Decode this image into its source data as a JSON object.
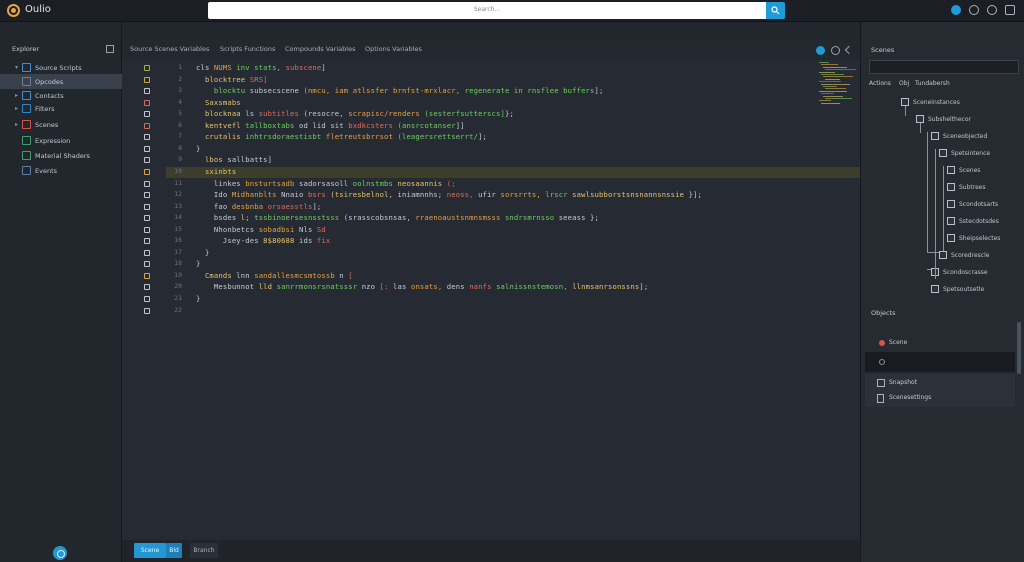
{
  "app": {
    "name": "Oulio"
  },
  "search": {
    "placeholder": "Search..."
  },
  "sidebar": {
    "header": "Explorer",
    "items": [
      {
        "label": "Source Scripts",
        "icon": "folder-icon",
        "color": "#3a8fd6",
        "active": false,
        "arrow": "▾"
      },
      {
        "label": "Opcodes",
        "icon": "file-icon",
        "color": "#6f7e92",
        "active": true,
        "arrow": ""
      },
      {
        "label": "Contacts",
        "icon": "folder-icon",
        "color": "#3a8fd6",
        "active": false,
        "arrow": "▸"
      },
      {
        "label": "Filters",
        "icon": "folder-icon",
        "color": "#2f86c9",
        "active": false,
        "arrow": "▸"
      },
      {
        "label": "Scenes",
        "icon": "folder-red-icon",
        "color": "#d8534a",
        "active": false,
        "arrow": "▸"
      },
      {
        "label": "Expression",
        "icon": "file-green-icon",
        "color": "#3f9e6b",
        "active": false,
        "arrow": ""
      },
      {
        "label": "Material Shaders",
        "icon": "file-green-icon",
        "color": "#3f9e6b",
        "active": false,
        "arrow": ""
      },
      {
        "label": "Events",
        "icon": "file-icon",
        "color": "#5b7fa8",
        "active": false,
        "arrow": ""
      }
    ]
  },
  "tabs": [
    {
      "label": "Source Scenes Variables"
    },
    {
      "label": "Scripts Functions"
    },
    {
      "label": "Compounds Variables"
    },
    {
      "label": "Options Variables"
    }
  ],
  "editor": {
    "line_numbers": [
      "1",
      "2",
      "3",
      "4",
      "5",
      "6",
      "7",
      "8",
      "9",
      "10",
      "11",
      "12",
      "13",
      "14",
      "15",
      "16",
      "17",
      "18",
      "19",
      "20",
      "21",
      "22"
    ],
    "lines": [
      [
        {
          "t": "cls ",
          "c": "#c3cdd6"
        },
        {
          "t": "NUMS ",
          "c": "#e8a33d"
        },
        {
          "t": "inv stats, ",
          "c": "#6fd15f"
        },
        {
          "t": "subscene",
          "c": "#e06d5c"
        },
        {
          "t": "]",
          "c": "#c3cdd6"
        }
      ],
      [
        {
          "t": "  blocktree ",
          "c": "#e8c46a"
        },
        {
          "t": "SRS]",
          "c": "#e06d5c"
        }
      ],
      [
        {
          "t": "    blocktu ",
          "c": "#6fd15f"
        },
        {
          "t": "subsecscene ",
          "c": "#c3cdd6"
        },
        {
          "t": "(nmcu, iam atlssfer brnfst-mrxlacr, ",
          "c": "#e8a33d"
        },
        {
          "t": "regenerate in rnsflee buffers",
          "c": "#6fd15f"
        },
        {
          "t": "];",
          "c": "#c3cdd6"
        }
      ],
      [
        {
          "t": "  Saxsmabs ",
          "c": "#e8c46a"
        }
      ],
      [
        {
          "t": "  blocknaa ",
          "c": "#e8c46a"
        },
        {
          "t": "ls ",
          "c": "#c3cdd6"
        },
        {
          "t": "subtitles ",
          "c": "#e06d5c"
        },
        {
          "t": "(resocre, ",
          "c": "#c3cdd6"
        },
        {
          "t": "scrapisc/renders ",
          "c": "#e8a33d"
        },
        {
          "t": "(sesterfsutterscs]",
          "c": "#6fd15f"
        },
        {
          "t": "};",
          "c": "#c3cdd6"
        }
      ],
      [
        {
          "t": "  kentvefl ",
          "c": "#e8c46a"
        },
        {
          "t": "tallboxtabs ",
          "c": "#6fd15f"
        },
        {
          "t": "od lid sit ",
          "c": "#c3cdd6"
        },
        {
          "t": "bxdkcsters ",
          "c": "#e06d5c"
        },
        {
          "t": "(ansrcotanser",
          "c": "#6fd15f"
        },
        {
          "t": "]]",
          "c": "#c3cdd6"
        }
      ],
      [
        {
          "t": "  crutalis ",
          "c": "#e8c46a"
        },
        {
          "t": "inhtrsdoraestisbt ",
          "c": "#6fd15f"
        },
        {
          "t": "fletreutsbrrsot ",
          "c": "#e8a33d"
        },
        {
          "t": "(leagersrettserrt/",
          "c": "#6fd15f"
        },
        {
          "t": "];",
          "c": "#c3cdd6"
        }
      ],
      [
        {
          "t": "}",
          "c": "#c3cdd6"
        }
      ],
      [
        {
          "t": "  lbos ",
          "c": "#e8c46a"
        },
        {
          "t": "sallbatts]",
          "c": "#c3cdd6"
        }
      ],
      [
        {
          "t": "  sxinbts ",
          "c": "#e8c46a"
        }
      ],
      [
        {
          "t": "    linkes ",
          "c": "#c3cdd6"
        },
        {
          "t": "bnsturtsadb ",
          "c": "#e8a33d"
        },
        {
          "t": "sadorsasoll ",
          "c": "#c3cdd6"
        },
        {
          "t": "oolnstmbs ",
          "c": "#6fd15f"
        },
        {
          "t": "neosaannis ",
          "c": "#e8c46a"
        },
        {
          "t": "(;",
          "c": "#e06d5c"
        }
      ],
      [
        {
          "t": "    Ido ",
          "c": "#c3cdd6"
        },
        {
          "t": "Midhanblts ",
          "c": "#e8a33d"
        },
        {
          "t": "Nnaio ",
          "c": "#c3cdd6"
        },
        {
          "t": "bsrs ",
          "c": "#e06d5c"
        },
        {
          "t": "(tsiresbelnol, ",
          "c": "#e8c46a"
        },
        {
          "t": "iniamnnhs; ",
          "c": "#c3cdd6"
        },
        {
          "t": "neoss, ",
          "c": "#e06d5c"
        },
        {
          "t": "ufir ",
          "c": "#c3cdd6"
        },
        {
          "t": "sorsrrts, ",
          "c": "#e8a33d"
        },
        {
          "t": "lrscr ",
          "c": "#6fd15f"
        },
        {
          "t": "sawlsubborstsnsnannsnssie ",
          "c": "#e8c46a"
        },
        {
          "t": "}];",
          "c": "#c3cdd6"
        }
      ],
      [
        {
          "t": "    fao ",
          "c": "#c3cdd6"
        },
        {
          "t": "desbnba ",
          "c": "#e8a33d"
        },
        {
          "t": "orsaesstls",
          "c": "#e06d5c"
        },
        {
          "t": "];",
          "c": "#c3cdd6"
        }
      ],
      [
        {
          "t": "    bsdes ",
          "c": "#c3cdd6"
        },
        {
          "t": "l; ",
          "c": "#e8c46a"
        },
        {
          "t": "tssbinoersesnsstsss ",
          "c": "#6fd15f"
        },
        {
          "t": "(srasscobsnsas, ",
          "c": "#c3cdd6"
        },
        {
          "t": "rraenoaustsnmnsmsss ",
          "c": "#e8a33d"
        },
        {
          "t": "sndrsmrnsso ",
          "c": "#6fd15f"
        },
        {
          "t": "seeass ",
          "c": "#c3cdd6"
        },
        {
          "t": "};",
          "c": "#c3cdd6"
        }
      ],
      [
        {
          "t": "    Nhonbetcs ",
          "c": "#c3cdd6"
        },
        {
          "t": "sobadbsi ",
          "c": "#e8a33d"
        },
        {
          "t": "Nls ",
          "c": "#c3cdd6"
        },
        {
          "t": "Sd",
          "c": "#e06d5c"
        }
      ],
      [
        {
          "t": "      Jsey-des ",
          "c": "#c3cdd6"
        },
        {
          "t": "8$80688 ",
          "c": "#e8c46a"
        },
        {
          "t": "ids ",
          "c": "#c3cdd6"
        },
        {
          "t": "fix",
          "c": "#e06d5c"
        }
      ],
      [
        {
          "t": "  }",
          "c": "#c3cdd6"
        }
      ],
      [
        {
          "t": "}",
          "c": "#c3cdd6"
        }
      ],
      [
        {
          "t": "  Cmands ",
          "c": "#e8c46a"
        },
        {
          "t": "lnn ",
          "c": "#c3cdd6"
        },
        {
          "t": "sandallesmcsmtossb ",
          "c": "#e8a33d"
        },
        {
          "t": "n ",
          "c": "#c3cdd6"
        },
        {
          "t": "[",
          "c": "#e06d5c"
        }
      ],
      [
        {
          "t": "    Mesbunnot ",
          "c": "#c3cdd6"
        },
        {
          "t": "lld ",
          "c": "#e8c46a"
        },
        {
          "t": "sanrrmonsrsnatsssr ",
          "c": "#6fd15f"
        },
        {
          "t": "nzo ",
          "c": "#c3cdd6"
        },
        {
          "t": "[: ",
          "c": "#e06d5c"
        },
        {
          "t": "las ",
          "c": "#c3cdd6"
        },
        {
          "t": "onsats, ",
          "c": "#e8a33d"
        },
        {
          "t": "dens ",
          "c": "#c3cdd6"
        },
        {
          "t": "nanfs ",
          "c": "#e06d5c"
        },
        {
          "t": "salnissnstemosn, ",
          "c": "#6fd15f"
        },
        {
          "t": "llnmsanrsonssns",
          "c": "#e8c46a"
        },
        {
          "t": "];",
          "c": "#c3cdd6"
        }
      ],
      [
        {
          "t": "}",
          "c": "#c3cdd6"
        }
      ],
      [
        {
          "t": "",
          "c": "#c3cdd6"
        }
      ]
    ],
    "gutter_marks": [
      {
        "line": 1,
        "color": "#9fb33f"
      },
      {
        "line": 2,
        "color": "#d0a63f"
      },
      {
        "line": 3,
        "color": "#c0c7cf"
      },
      {
        "line": 4,
        "color": "#d36b5a"
      },
      {
        "line": 5,
        "color": "#c0c7cf"
      },
      {
        "line": 6,
        "color": "#d36b5a"
      },
      {
        "line": 7,
        "color": "#c0c7cf"
      },
      {
        "line": 8,
        "color": "#c0c7cf"
      },
      {
        "line": 9,
        "color": "#c0c7cf"
      },
      {
        "line": 10,
        "color": "#d0a63f"
      },
      {
        "line": 11,
        "color": "#c0c7cf"
      },
      {
        "line": 12,
        "color": "#c0c7cf"
      },
      {
        "line": 13,
        "color": "#c0c7cf"
      },
      {
        "line": 14,
        "color": "#c0c7cf"
      },
      {
        "line": 15,
        "color": "#c0c7cf"
      },
      {
        "line": 16,
        "color": "#c0c7cf"
      },
      {
        "line": 17,
        "color": "#c0c7cf"
      },
      {
        "line": 18,
        "color": "#c0c7cf"
      },
      {
        "line": 19,
        "color": "#d0a63f"
      },
      {
        "line": 20,
        "color": "#c0c7cf"
      },
      {
        "line": 21,
        "color": "#c0c7cf"
      },
      {
        "line": 22,
        "color": "#c0c7cf"
      }
    ],
    "highlighted_line": 10
  },
  "bottombar": {
    "primary_label": "Scene",
    "secondary_label": "Bld",
    "tertiary_label": "Branch"
  },
  "rightpanel": {
    "title": "Scenes",
    "tree_header": [
      {
        "label": "Actions"
      },
      {
        "label": "Obj"
      },
      {
        "label": "Tundabersh"
      }
    ],
    "tree": [
      {
        "label": "Sceneinstances",
        "depth": 1
      },
      {
        "label": "Subshelthecor",
        "depth": 2
      },
      {
        "label": "Sceneobjected",
        "depth": 3
      },
      {
        "label": "Spetsintence",
        "depth": 4
      },
      {
        "label": "Scenes",
        "depth": 5
      },
      {
        "label": "Subtrees",
        "depth": 5
      },
      {
        "label": "Scondotsarts",
        "depth": 5
      },
      {
        "label": "Sstecdotsdes",
        "depth": 5
      },
      {
        "label": "Sheipselectes",
        "depth": 5
      },
      {
        "label": "Scoredrescle",
        "depth": 4
      },
      {
        "label": "Scondoscrasse",
        "depth": 3
      },
      {
        "label": "Spetsoutsetle",
        "depth": 3
      }
    ],
    "section_title": "Objects",
    "section_rows": [
      {
        "label": "Scene",
        "icon": "circle-red-icon"
      },
      {
        "label": "",
        "icon": "circle-icon"
      }
    ],
    "footer_rows": [
      {
        "label": "Snapshot"
      },
      {
        "label": "Scenesettings"
      }
    ]
  },
  "colors": {
    "accent": "#1f9bd6",
    "logo": "#e7a343",
    "highlight_line": "#3d3d2c"
  }
}
